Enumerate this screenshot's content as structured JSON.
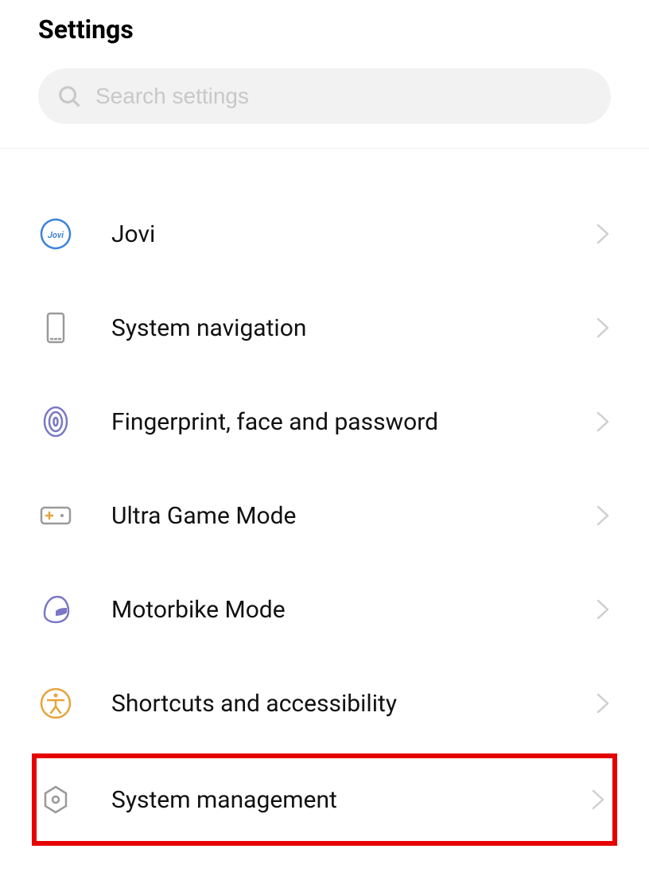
{
  "header": {
    "title": "Settings"
  },
  "search": {
    "placeholder": "Search settings"
  },
  "list": {
    "items": [
      {
        "id": "jovi",
        "label": "Jovi",
        "icon": "jovi-icon",
        "highlighted": false
      },
      {
        "id": "system-navigation",
        "label": "System navigation",
        "icon": "phone-icon",
        "highlighted": false
      },
      {
        "id": "fingerprint-face-password",
        "label": "Fingerprint, face and password",
        "icon": "fingerprint-icon",
        "highlighted": false
      },
      {
        "id": "ultra-game-mode",
        "label": "Ultra Game Mode",
        "icon": "gamepad-icon",
        "highlighted": false
      },
      {
        "id": "motorbike-mode",
        "label": "Motorbike Mode",
        "icon": "helmet-icon",
        "highlighted": false
      },
      {
        "id": "shortcuts-accessibility",
        "label": "Shortcuts and accessibility",
        "icon": "accessibility-icon",
        "highlighted": false
      },
      {
        "id": "system-management",
        "label": "System management",
        "icon": "gear-hex-icon",
        "highlighted": true
      }
    ]
  },
  "colors": {
    "joviBlue": "#3b82d8",
    "purpleIcon": "#7a78c4",
    "grayIcon": "#9a9a9a",
    "orangeIcon": "#e6a43a",
    "highlightRed": "#e60000",
    "chevron": "#cfcfcf",
    "searchIcon": "#c8c8c8"
  }
}
